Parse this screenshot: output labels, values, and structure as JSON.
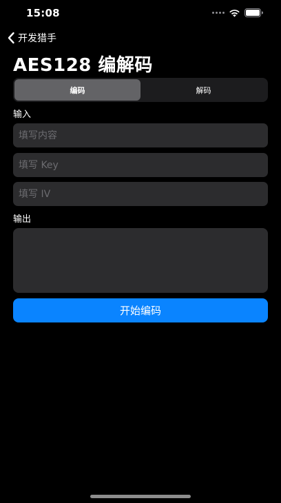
{
  "status_bar": {
    "time": "15:08"
  },
  "nav": {
    "back_label": "开发猎手"
  },
  "page": {
    "title": "AES128 编解码"
  },
  "mode_tabs": [
    {
      "label": "编码",
      "selected": true
    },
    {
      "label": "解码",
      "selected": false
    }
  ],
  "input_section": {
    "label": "输入",
    "content_placeholder": "填写内容",
    "content_value": "",
    "key_placeholder": "填写 Key",
    "key_value": "",
    "iv_placeholder": "填写 IV",
    "iv_value": ""
  },
  "output_section": {
    "label": "输出",
    "value": ""
  },
  "action": {
    "label": "开始编码"
  },
  "colors": {
    "accent": "#0a84ff",
    "field_background": "#2c2c2e",
    "segment_selected": "#636366",
    "background": "#000000"
  }
}
